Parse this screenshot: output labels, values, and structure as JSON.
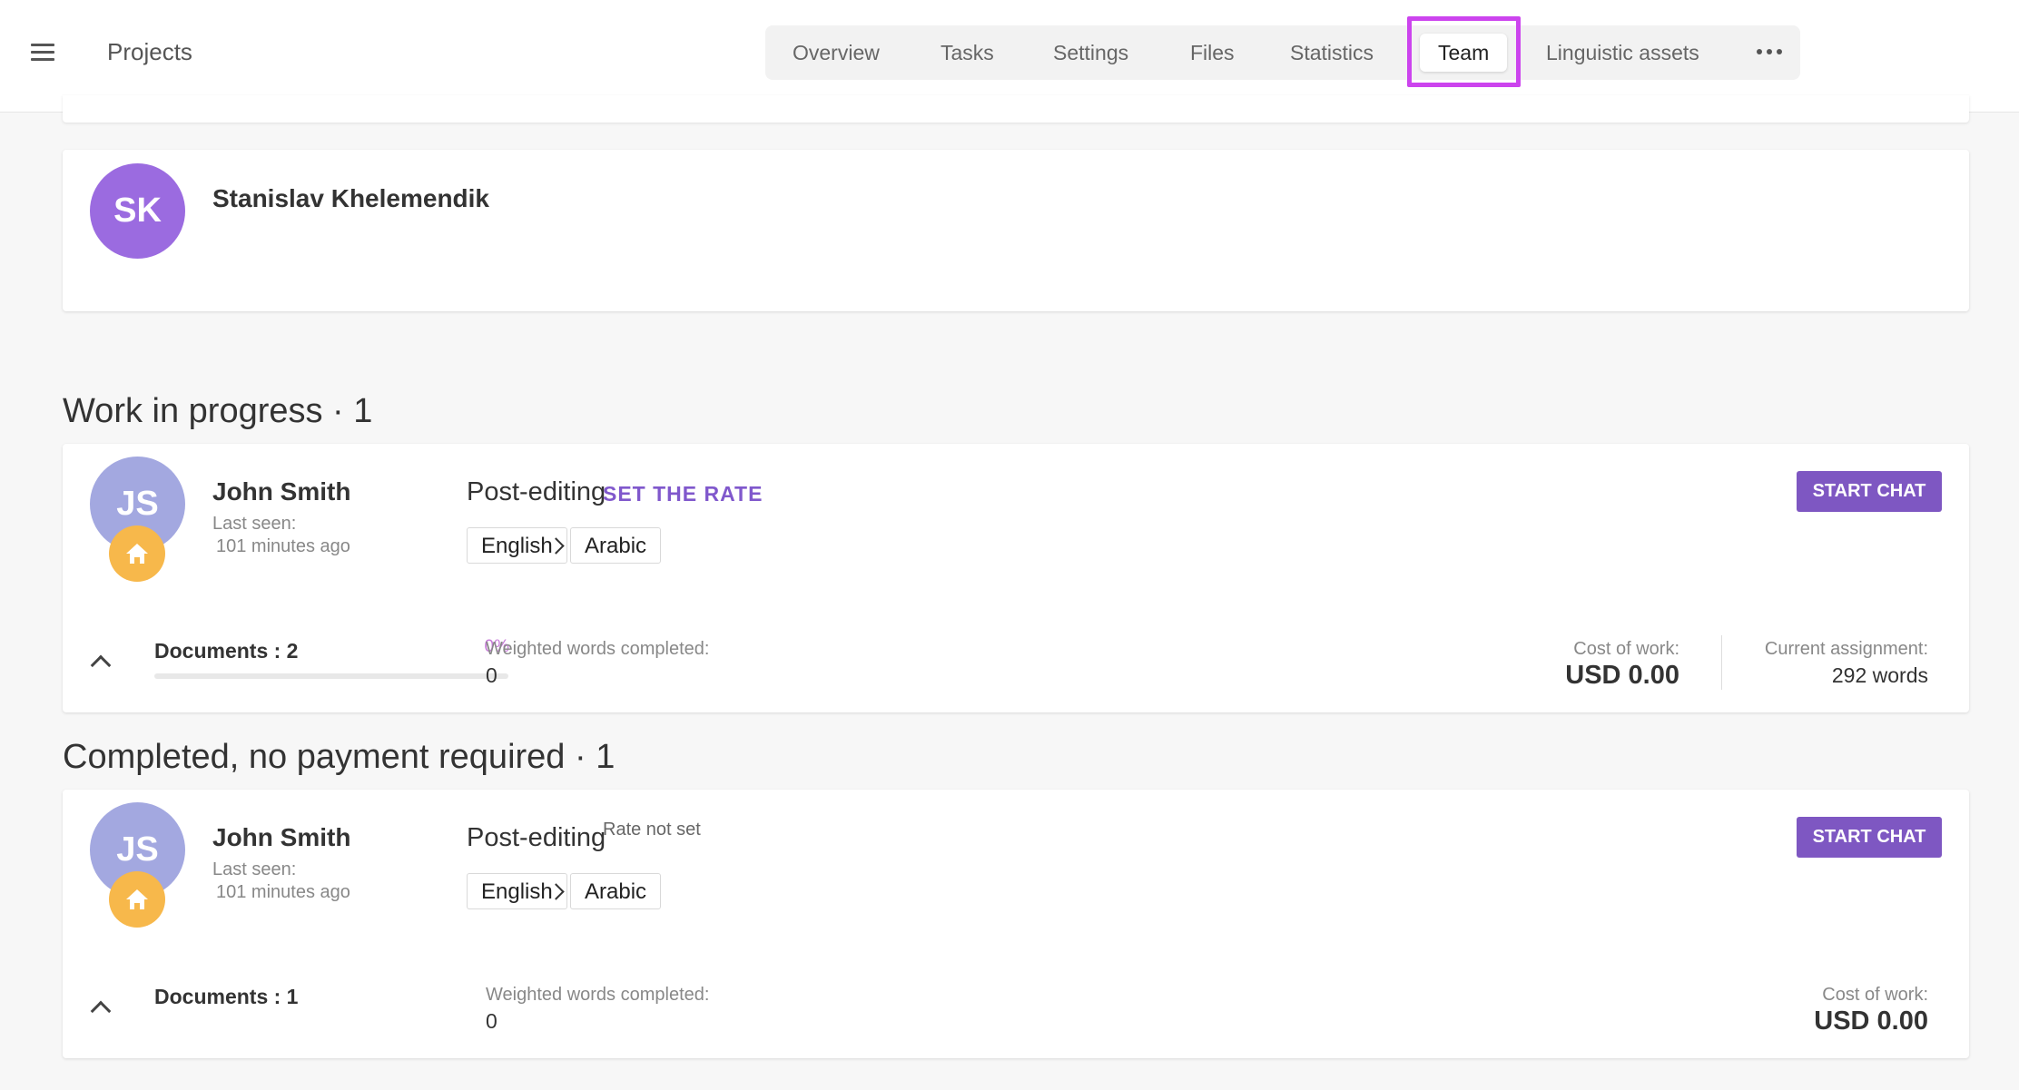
{
  "header": {
    "title": "Projects",
    "tabs": [
      "Overview",
      "Tasks",
      "Settings",
      "Files",
      "Statistics",
      "Team",
      "Linguistic assets"
    ],
    "active_tab": "Team"
  },
  "manager": {
    "initials": "SK",
    "name": "Stanislav Khelemendik"
  },
  "sections": {
    "in_progress": {
      "heading": "Work in progress · 1",
      "member": {
        "initials": "JS",
        "name": "John Smith",
        "last_seen_label": "Last seen:",
        "last_seen_value": "101 minutes ago",
        "task": "Post-editing",
        "rate_action": "SET THE RATE",
        "source_lang": "English",
        "target_lang": "Arabic",
        "chat_label": "START CHAT",
        "documents_label": "Documents : 2",
        "progress_pct": "0%",
        "progress_value": 0,
        "weighted_label": "Weighted words completed:",
        "weighted_value": "0",
        "cost_label": "Cost of work:",
        "cost_value": "USD 0.00",
        "assignment_label": "Current assignment:",
        "assignment_value": "292 words"
      }
    },
    "completed": {
      "heading": "Completed, no payment required · 1",
      "member": {
        "initials": "JS",
        "name": "John Smith",
        "last_seen_label": "Last seen:",
        "last_seen_value": "101 minutes ago",
        "task": "Post-editing",
        "rate_note": "Rate not set",
        "source_lang": "English",
        "target_lang": "Arabic",
        "chat_label": "START CHAT",
        "documents_label": "Documents : 1",
        "weighted_label": "Weighted words completed:",
        "weighted_value": "0",
        "cost_label": "Cost of work:",
        "cost_value": "USD 0.00"
      }
    }
  },
  "colors": {
    "accent": "#7e57c2",
    "avatar_manager": "#9b6be0",
    "avatar_member": "#a3a8e0",
    "home_badge": "#f7b84b",
    "tab_highlight": "#cc44ee",
    "progress": "#c77ad8"
  }
}
